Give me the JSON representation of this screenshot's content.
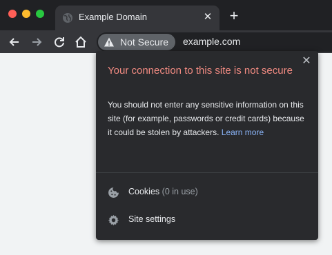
{
  "tab": {
    "title": "Example Domain",
    "close_glyph": "✕"
  },
  "new_tab_glyph": "+",
  "toolbar": {
    "security_chip": "Not Secure",
    "url": "example.com"
  },
  "popup": {
    "close_glyph": "✕",
    "title": "Your connection to this site is not secure",
    "body": "You should not enter any sensitive information on this site (for example, passwords or credit cards) because it could be stolen by attackers.",
    "learn_more": "Learn more",
    "cookies_label": "Cookies",
    "cookies_count": "(0 in use)",
    "site_settings_label": "Site settings"
  },
  "colors": {
    "warning_title": "#f28b82",
    "link": "#8ab4f8",
    "popup_bg": "#292a2d",
    "chrome_bg": "#202124",
    "toolbar_bg": "#35363a"
  },
  "icons": {
    "close_red": "traffic-light-close-icon",
    "minimize_yellow": "traffic-light-minimize-icon",
    "zoom_green": "traffic-light-zoom-icon",
    "favicon": "globe-icon",
    "back": "back-arrow-icon",
    "forward": "forward-arrow-icon",
    "reload": "reload-icon",
    "home": "home-icon",
    "warning": "warning-triangle-icon",
    "cookies": "cookie-icon",
    "settings": "gear-icon"
  }
}
